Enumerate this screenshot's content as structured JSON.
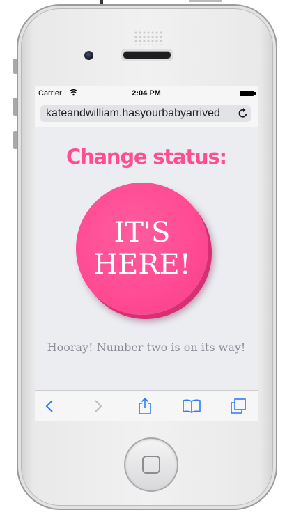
{
  "status_bar": {
    "carrier": "Carrier",
    "time": "2:04 PM"
  },
  "browser": {
    "url": "kateandwilliam.hasyourbabyarrived",
    "reload_icon": "reload-icon"
  },
  "page": {
    "heading": "Change status:",
    "button_line1": "IT'S",
    "button_line2": "HERE!",
    "tagline": "Hooray! Number two is on its way!"
  },
  "colors": {
    "accent": "#ff4d92",
    "button": "#ff4a93",
    "toolbar_icon": "#2f7cf6",
    "disabled_icon": "#b9bcc4"
  },
  "toolbar": {
    "icons": [
      "back-icon",
      "forward-icon",
      "share-icon",
      "bookmarks-icon",
      "tabs-icon"
    ]
  }
}
